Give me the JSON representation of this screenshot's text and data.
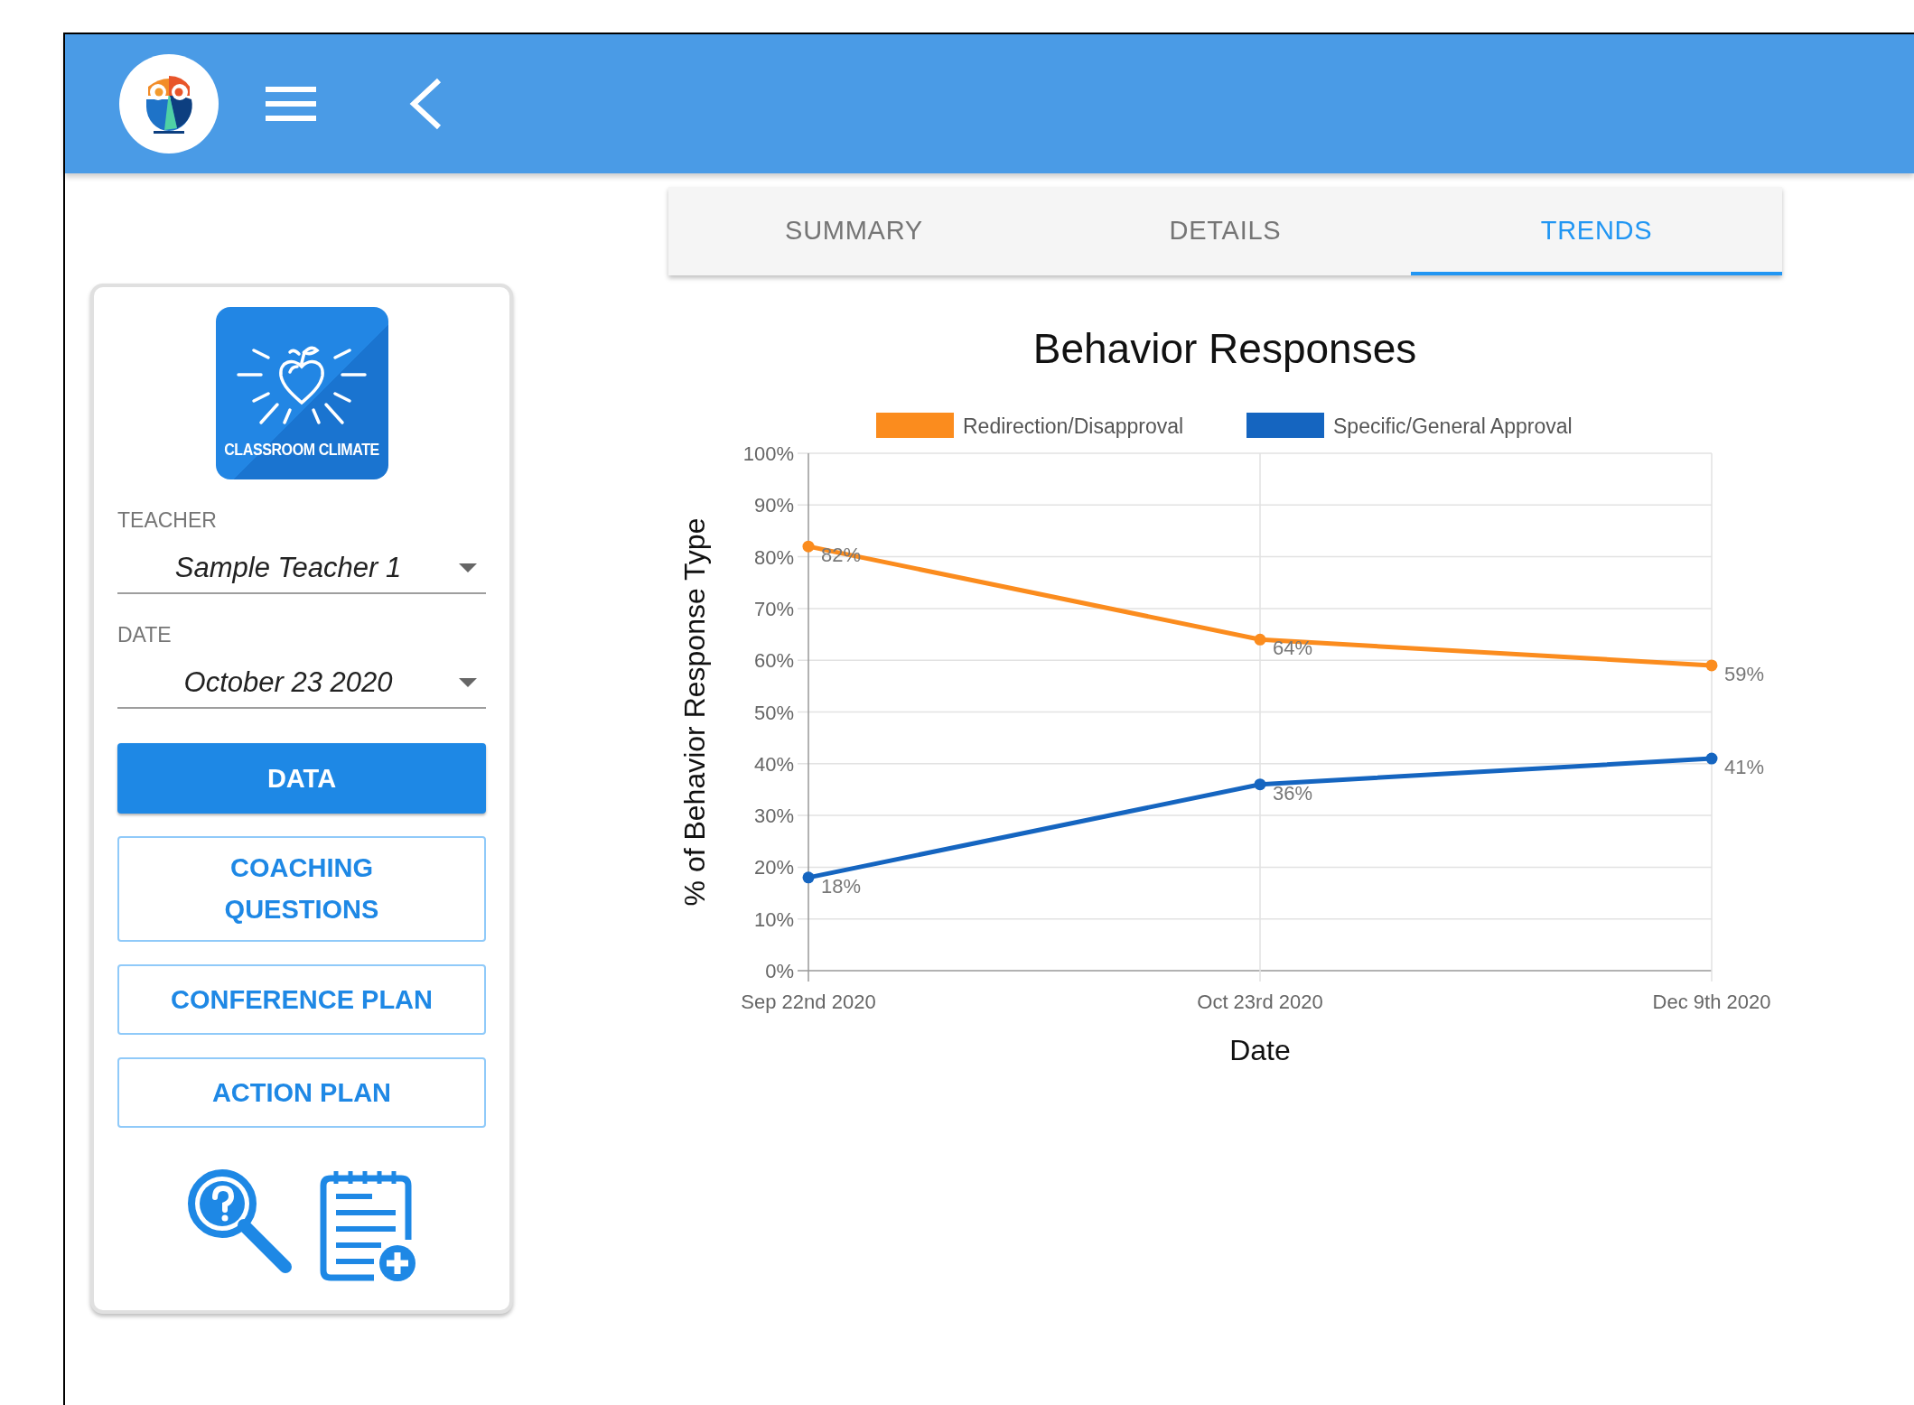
{
  "sidebar": {
    "tile_label": "CLASSROOM CLIMATE",
    "fields": [
      {
        "label": "TEACHER",
        "value": "Sample Teacher 1"
      },
      {
        "label": "DATE",
        "value": "October 23 2020"
      }
    ],
    "buttons": [
      {
        "label": "DATA",
        "selected": true
      },
      {
        "label": "COACHING QUESTIONS",
        "selected": false
      },
      {
        "label": "CONFERENCE PLAN",
        "selected": false
      },
      {
        "label": "ACTION PLAN",
        "selected": false
      }
    ]
  },
  "tabs": [
    {
      "label": "SUMMARY",
      "selected": false
    },
    {
      "label": "DETAILS",
      "selected": false
    },
    {
      "label": "TRENDS",
      "selected": true
    }
  ],
  "chart": {
    "chart_data": {
      "type": "line",
      "title": "Behavior Responses",
      "xlabel": "Date",
      "ylabel": "% of Behavior Response Type",
      "categories": [
        "Sep 22nd 2020",
        "Oct 23rd 2020",
        "Dec 9th 2020"
      ],
      "series": [
        {
          "name": "Redirection/Disapproval",
          "color": "#fb8c1e",
          "marker": "circle",
          "values": [
            82,
            64,
            59
          ]
        },
        {
          "name": "Specific/General Approval",
          "color": "#1565c0",
          "marker": "circle",
          "values": [
            18,
            36,
            41
          ]
        }
      ],
      "ylim": [
        0,
        100
      ],
      "grid": true,
      "legend": true,
      "yticks": [
        {
          "value": 0,
          "label": "0%"
        },
        {
          "value": 10,
          "label": "10%"
        },
        {
          "value": 20,
          "label": "20%"
        },
        {
          "value": 30,
          "label": "30%"
        },
        {
          "value": 40,
          "label": "40%"
        },
        {
          "value": 50,
          "label": "50%"
        },
        {
          "value": 60,
          "label": "60%"
        },
        {
          "value": 70,
          "label": "70%"
        },
        {
          "value": 80,
          "label": "80%"
        },
        {
          "value": 90,
          "label": "90%"
        },
        {
          "value": 100,
          "label": "100%"
        }
      ],
      "value_labels": [
        [
          "82%",
          "64%",
          "59%"
        ],
        [
          "18%",
          "36%",
          "41%"
        ]
      ]
    }
  }
}
